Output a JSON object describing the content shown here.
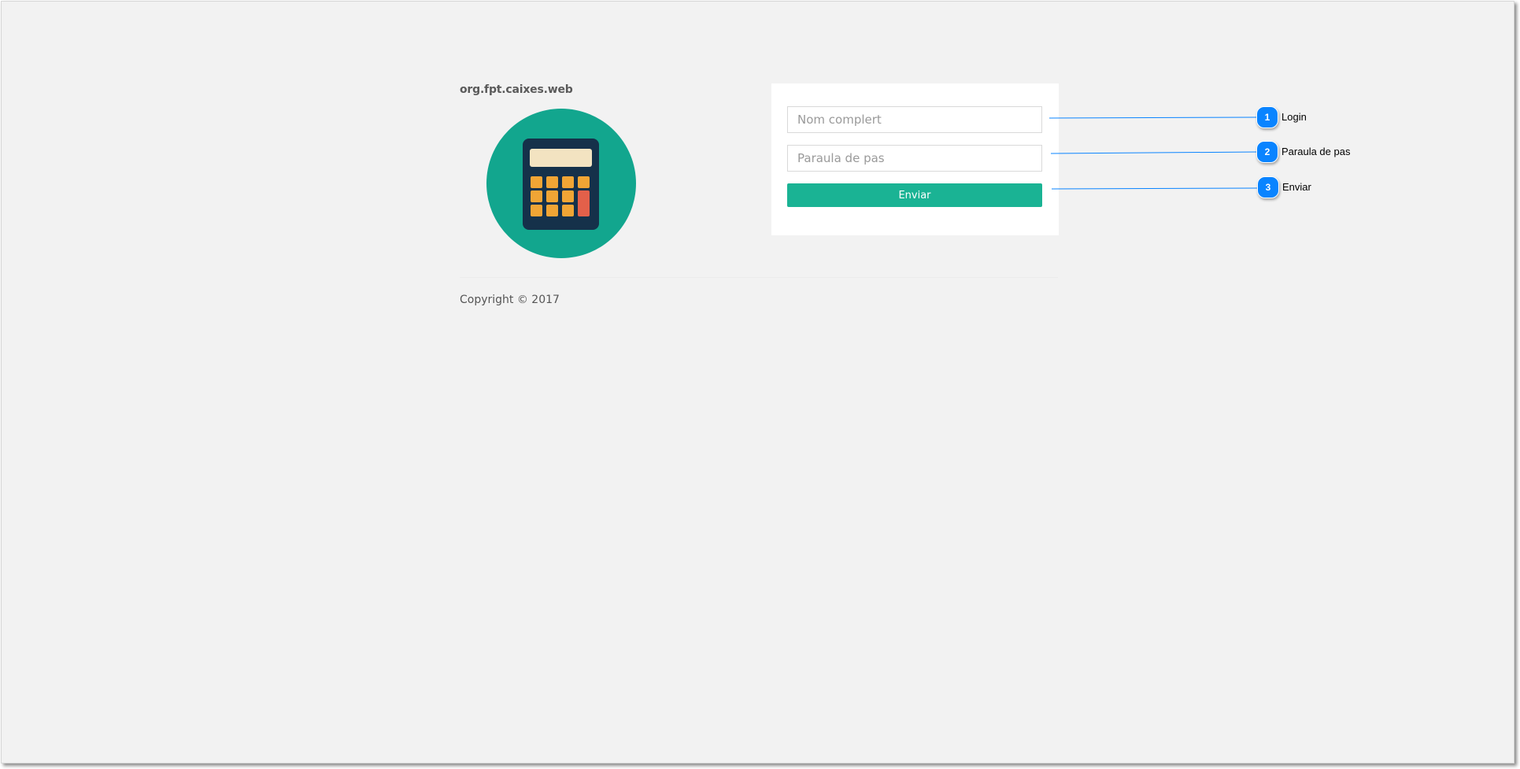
{
  "app": {
    "name": "org.fpt.caixes.web",
    "copyright": "Copyright © 2017"
  },
  "form": {
    "login_placeholder": "Nom complert",
    "login_value": "",
    "password_placeholder": "Paraula de pas",
    "password_value": "",
    "submit_label": "Enviar"
  },
  "callouts": [
    {
      "number": "1",
      "label": "Login"
    },
    {
      "number": "2",
      "label": "Paraula de pas"
    },
    {
      "number": "3",
      "label": "Enviar"
    }
  ],
  "icons": {
    "logo": "calculator-icon"
  },
  "colors": {
    "background": "#f2f2f2",
    "accent": "#1ab394",
    "logo_circle": "#12a68e",
    "calculator_body": "#15314a",
    "calculator_screen": "#f3e3c1",
    "calculator_keys": "#f0a535",
    "calculator_equals": "#e3604a",
    "callout": "#0a84ff"
  }
}
